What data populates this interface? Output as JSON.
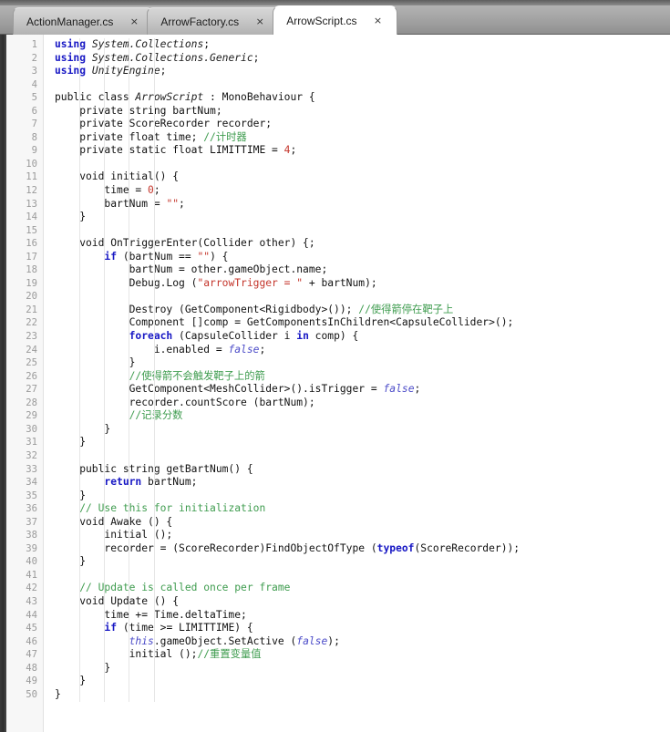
{
  "window": {
    "title": "ArrowScript.cs",
    "app_kind": "code-editor"
  },
  "tabbar": {
    "tabs": [
      {
        "label": "ActionManager.cs",
        "active": false,
        "close_glyph": "×"
      },
      {
        "label": "ArrowFactory.cs",
        "active": false,
        "close_glyph": "×"
      },
      {
        "label": "ArrowScript.cs",
        "active": true,
        "close_glyph": "×"
      }
    ]
  },
  "editor": {
    "language": "csharp",
    "first_line": 1,
    "last_line": 50,
    "total_lines": 50,
    "line_numbers": [
      "1",
      "2",
      "3",
      "4",
      "5",
      "6",
      "7",
      "8",
      "9",
      "10",
      "11",
      "12",
      "13",
      "14",
      "15",
      "16",
      "17",
      "18",
      "19",
      "20",
      "21",
      "22",
      "23",
      "24",
      "25",
      "26",
      "27",
      "28",
      "29",
      "30",
      "31",
      "32",
      "33",
      "34",
      "35",
      "36",
      "37",
      "38",
      "39",
      "40",
      "41",
      "42",
      "43",
      "44",
      "45",
      "46",
      "47",
      "48",
      "49",
      "50"
    ],
    "lines": [
      {
        "n": 1,
        "tokens": [
          {
            "t": "using",
            "c": "k-using"
          },
          {
            "t": " ",
            "c": "plain"
          },
          {
            "t": "System.Collections",
            "c": "ns"
          },
          {
            "t": ";",
            "c": "plain"
          }
        ]
      },
      {
        "n": 2,
        "tokens": [
          {
            "t": "using",
            "c": "k-using"
          },
          {
            "t": " ",
            "c": "plain"
          },
          {
            "t": "System.Collections.Generic",
            "c": "ns"
          },
          {
            "t": ";",
            "c": "plain"
          }
        ]
      },
      {
        "n": 3,
        "tokens": [
          {
            "t": "using",
            "c": "k-using"
          },
          {
            "t": " ",
            "c": "plain"
          },
          {
            "t": "UnityEngine",
            "c": "ns"
          },
          {
            "t": ";",
            "c": "plain"
          }
        ]
      },
      {
        "n": 4,
        "tokens": []
      },
      {
        "n": 5,
        "tokens": [
          {
            "t": "public class ",
            "c": "plain"
          },
          {
            "t": "ArrowScript",
            "c": "type-it"
          },
          {
            "t": " : MonoBehaviour {",
            "c": "plain"
          }
        ]
      },
      {
        "n": 6,
        "tokens": [
          {
            "t": "    private string bartNum;",
            "c": "plain"
          }
        ]
      },
      {
        "n": 7,
        "tokens": [
          {
            "t": "    private ScoreRecorder recorder;",
            "c": "plain"
          }
        ]
      },
      {
        "n": 8,
        "tokens": [
          {
            "t": "    private float time; ",
            "c": "plain"
          },
          {
            "t": "//计时器",
            "c": "cmt"
          }
        ]
      },
      {
        "n": 9,
        "tokens": [
          {
            "t": "    private static float LIMITTIME = ",
            "c": "plain"
          },
          {
            "t": "4",
            "c": "num"
          },
          {
            "t": ";",
            "c": "plain"
          }
        ]
      },
      {
        "n": 10,
        "tokens": []
      },
      {
        "n": 11,
        "tokens": [
          {
            "t": "    void initial() {",
            "c": "plain"
          }
        ]
      },
      {
        "n": 12,
        "tokens": [
          {
            "t": "        time = ",
            "c": "plain"
          },
          {
            "t": "0",
            "c": "num"
          },
          {
            "t": ";",
            "c": "plain"
          }
        ]
      },
      {
        "n": 13,
        "tokens": [
          {
            "t": "        bartNum = ",
            "c": "plain"
          },
          {
            "t": "\"\"",
            "c": "str"
          },
          {
            "t": ";",
            "c": "plain"
          }
        ]
      },
      {
        "n": 14,
        "tokens": [
          {
            "t": "    }",
            "c": "plain"
          }
        ]
      },
      {
        "n": 15,
        "tokens": []
      },
      {
        "n": 16,
        "tokens": [
          {
            "t": "    void OnTriggerEnter(Collider other) {;",
            "c": "plain"
          }
        ]
      },
      {
        "n": 17,
        "tokens": [
          {
            "t": "        ",
            "c": "plain"
          },
          {
            "t": "if",
            "c": "k-blue"
          },
          {
            "t": " (bartNum == ",
            "c": "plain"
          },
          {
            "t": "\"\"",
            "c": "str"
          },
          {
            "t": ") {",
            "c": "plain"
          }
        ]
      },
      {
        "n": 18,
        "tokens": [
          {
            "t": "            bartNum = other.gameObject.name;",
            "c": "plain"
          }
        ]
      },
      {
        "n": 19,
        "tokens": [
          {
            "t": "            Debug.Log (",
            "c": "plain"
          },
          {
            "t": "\"arrowTrigger = \"",
            "c": "str"
          },
          {
            "t": " + bartNum);",
            "c": "plain"
          }
        ]
      },
      {
        "n": 20,
        "tokens": []
      },
      {
        "n": 21,
        "tokens": [
          {
            "t": "            Destroy (GetComponent<Rigidbody>()); ",
            "c": "plain"
          },
          {
            "t": "//使得箭停在靶子上",
            "c": "cmt"
          }
        ]
      },
      {
        "n": 22,
        "tokens": [
          {
            "t": "            Component []comp = GetComponentsInChildren<CapsuleCollider>();",
            "c": "plain"
          }
        ]
      },
      {
        "n": 23,
        "tokens": [
          {
            "t": "            ",
            "c": "plain"
          },
          {
            "t": "foreach",
            "c": "k-blue"
          },
          {
            "t": " (CapsuleCollider i ",
            "c": "plain"
          },
          {
            "t": "in",
            "c": "k-blue"
          },
          {
            "t": " comp) {",
            "c": "plain"
          }
        ]
      },
      {
        "n": 24,
        "tokens": [
          {
            "t": "                i.enabled = ",
            "c": "plain"
          },
          {
            "t": "false",
            "c": "kw-it"
          },
          {
            "t": ";",
            "c": "plain"
          }
        ]
      },
      {
        "n": 25,
        "tokens": [
          {
            "t": "            }",
            "c": "plain"
          }
        ]
      },
      {
        "n": 26,
        "tokens": [
          {
            "t": "            ",
            "c": "plain"
          },
          {
            "t": "//使得箭不会触发靶子上的箭",
            "c": "cmt"
          }
        ]
      },
      {
        "n": 27,
        "tokens": [
          {
            "t": "            GetComponent<MeshCollider>().isTrigger = ",
            "c": "plain"
          },
          {
            "t": "false",
            "c": "kw-it"
          },
          {
            "t": ";",
            "c": "plain"
          }
        ]
      },
      {
        "n": 28,
        "tokens": [
          {
            "t": "            recorder.countScore (bartNum);",
            "c": "plain"
          }
        ]
      },
      {
        "n": 29,
        "tokens": [
          {
            "t": "            ",
            "c": "plain"
          },
          {
            "t": "//记录分数",
            "c": "cmt"
          }
        ]
      },
      {
        "n": 30,
        "tokens": [
          {
            "t": "        }",
            "c": "plain"
          }
        ]
      },
      {
        "n": 31,
        "tokens": [
          {
            "t": "    }",
            "c": "plain"
          }
        ]
      },
      {
        "n": 32,
        "tokens": []
      },
      {
        "n": 33,
        "tokens": [
          {
            "t": "    public string getBartNum() {",
            "c": "plain"
          }
        ]
      },
      {
        "n": 34,
        "tokens": [
          {
            "t": "        ",
            "c": "plain"
          },
          {
            "t": "return",
            "c": "k-blue"
          },
          {
            "t": " bartNum;",
            "c": "plain"
          }
        ]
      },
      {
        "n": 35,
        "tokens": [
          {
            "t": "    }",
            "c": "plain"
          }
        ]
      },
      {
        "n": 36,
        "tokens": [
          {
            "t": "    ",
            "c": "plain"
          },
          {
            "t": "// Use this for initialization",
            "c": "cmt"
          }
        ]
      },
      {
        "n": 37,
        "tokens": [
          {
            "t": "    void Awake () {",
            "c": "plain"
          }
        ]
      },
      {
        "n": 38,
        "tokens": [
          {
            "t": "        initial ();",
            "c": "plain"
          }
        ]
      },
      {
        "n": 39,
        "tokens": [
          {
            "t": "        recorder = (ScoreRecorder)FindObjectOfType (",
            "c": "plain"
          },
          {
            "t": "typeof",
            "c": "k-blue"
          },
          {
            "t": "(ScoreRecorder));",
            "c": "plain"
          }
        ]
      },
      {
        "n": 40,
        "tokens": [
          {
            "t": "    }",
            "c": "plain"
          }
        ]
      },
      {
        "n": 41,
        "tokens": []
      },
      {
        "n": 42,
        "tokens": [
          {
            "t": "    ",
            "c": "plain"
          },
          {
            "t": "// Update is called once per frame",
            "c": "cmt"
          }
        ]
      },
      {
        "n": 43,
        "tokens": [
          {
            "t": "    void Update () {",
            "c": "plain"
          }
        ]
      },
      {
        "n": 44,
        "tokens": [
          {
            "t": "        time += Time.deltaTime;",
            "c": "plain"
          }
        ]
      },
      {
        "n": 45,
        "tokens": [
          {
            "t": "        ",
            "c": "plain"
          },
          {
            "t": "if",
            "c": "k-blue"
          },
          {
            "t": " (time >= LIMITTIME) {",
            "c": "plain"
          }
        ]
      },
      {
        "n": 46,
        "tokens": [
          {
            "t": "            ",
            "c": "plain"
          },
          {
            "t": "this",
            "c": "kw-it"
          },
          {
            "t": ".gameObject.SetActive (",
            "c": "plain"
          },
          {
            "t": "false",
            "c": "kw-it"
          },
          {
            "t": ");",
            "c": "plain"
          }
        ]
      },
      {
        "n": 47,
        "tokens": [
          {
            "t": "            initial ();",
            "c": "plain"
          },
          {
            "t": "//重置变量值",
            "c": "cmt"
          }
        ]
      },
      {
        "n": 48,
        "tokens": [
          {
            "t": "        }",
            "c": "plain"
          }
        ]
      },
      {
        "n": 49,
        "tokens": [
          {
            "t": "    }",
            "c": "plain"
          }
        ]
      },
      {
        "n": 50,
        "tokens": [
          {
            "t": "}",
            "c": "plain"
          }
        ]
      }
    ],
    "indent_guide_columns": [
      4,
      8,
      12,
      16
    ]
  },
  "colors": {
    "keyword": "#1717c4",
    "keyword_italic": "#4b4bc8",
    "string": "#c4352b",
    "number": "#c4352b",
    "comment": "#3f9c4f",
    "text": "#111111",
    "gutter_bg": "#f7f7f7",
    "gutter_text": "#9a9a9a",
    "editor_bg": "#ffffff",
    "tabbar_bg": "#a9a9a9",
    "active_tab_bg": "#ffffff"
  }
}
